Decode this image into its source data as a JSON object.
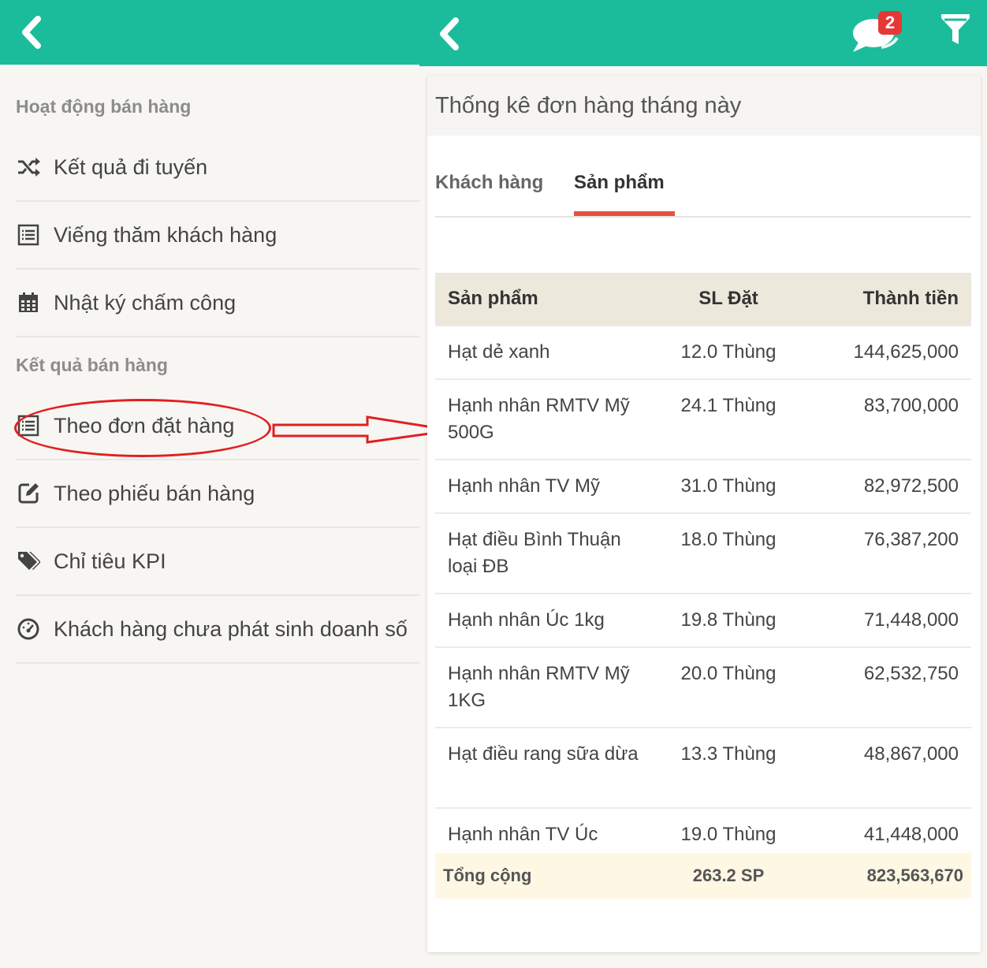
{
  "left": {
    "section_activity": "Hoạt động bán hàng",
    "section_results": "Kết quả bán hàng",
    "items": [
      {
        "label": "Kết quả đi tuyến",
        "icon": "shuffle-icon"
      },
      {
        "label": "Viếng thăm khách hàng",
        "icon": "list-icon"
      },
      {
        "label": "Nhật ký chấm công",
        "icon": "calendar-icon"
      },
      {
        "label": "Theo đơn đặt hàng",
        "icon": "list-icon"
      },
      {
        "label": "Theo phiếu bán hàng",
        "icon": "edit-icon"
      },
      {
        "label": "Chỉ tiêu KPI",
        "icon": "tags-icon"
      },
      {
        "label": "Khách hàng chưa phát sinh doanh số",
        "icon": "dashboard-icon"
      }
    ]
  },
  "right": {
    "notification_count": "2",
    "card_title": "Thống kê đơn hàng tháng này",
    "tabs": [
      {
        "label": "Khách hàng",
        "active": false
      },
      {
        "label": "Sản phẩm",
        "active": true
      }
    ],
    "table": {
      "headers": [
        "Sản phẩm",
        "SL Đặt",
        "Thành tiền"
      ],
      "rows": [
        {
          "product": "Hạt dẻ xanh",
          "qty": "12.0 Thùng",
          "amount": "144,625,000"
        },
        {
          "product": "Hạnh nhân RMTV Mỹ 500G",
          "qty": "24.1 Thùng",
          "amount": "83,700,000"
        },
        {
          "product": "Hạnh nhân TV Mỹ",
          "qty": "31.0 Thùng",
          "amount": "82,972,500"
        },
        {
          "product": "Hạt điều Bình Thuận loại ĐB",
          "qty": "18.0 Thùng",
          "amount": "76,387,200"
        },
        {
          "product": "Hạnh nhân Úc 1kg",
          "qty": "19.8 Thùng",
          "amount": "71,448,000"
        },
        {
          "product": "Hạnh nhân RMTV Mỹ 1KG",
          "qty": "20.0 Thùng",
          "amount": "62,532,750"
        },
        {
          "product": "Hạt điều rang sữa dừa",
          "qty": "13.3 Thùng",
          "amount": "48,867,000"
        },
        {
          "product": "Hạnh nhân TV Úc",
          "qty": "19.0 Thùng",
          "amount": "41,448,000"
        }
      ],
      "total": {
        "label": "Tổng cộng",
        "qty": "263.2 SP",
        "amount": "823,563,670"
      }
    }
  },
  "colors": {
    "primary": "#1abc9c",
    "accent": "#e5533c",
    "annotation": "#e02020"
  }
}
